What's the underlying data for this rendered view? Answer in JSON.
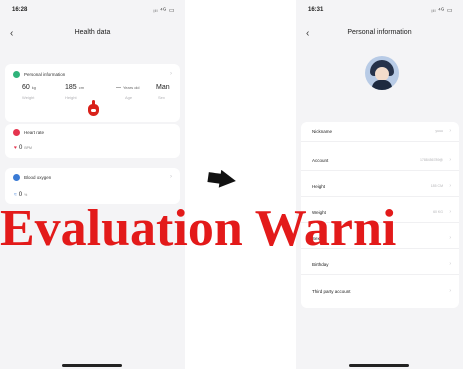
{
  "left_screen": {
    "status_time": "16:28",
    "status_icons": "ᵢₗₗ ⁴ᴳ ▭",
    "title": "Health data",
    "personal_card": {
      "title": "Personal information",
      "stats": [
        {
          "value": "60",
          "unit": "kg",
          "label": "Weight"
        },
        {
          "value": "185",
          "unit": "cm",
          "label": "Height"
        },
        {
          "value": "—",
          "unit": "Years old",
          "label": "Age"
        },
        {
          "value": "Man",
          "unit": "",
          "label": "Sex"
        }
      ]
    },
    "heart_card": {
      "title": "Heart rate",
      "value": "0",
      "unit": "BPM"
    },
    "oxygen_card": {
      "title": "Blood oxygen",
      "value": "0",
      "unit": "%"
    }
  },
  "right_screen": {
    "status_time": "16:31",
    "status_icons": "ᵢₗₗ ⁴ᴳ ▭",
    "title": "Personal information",
    "rows": [
      {
        "label": "Nickname",
        "value": "yuuu"
      },
      {
        "label": "Account",
        "value": "1788456789@"
      },
      {
        "label": "Height",
        "value": "185 CM"
      },
      {
        "label": "Weight",
        "value": "60 KG"
      },
      {
        "label": "Sex",
        "value": ""
      },
      {
        "label": "Birthday",
        "value": ""
      },
      {
        "label": "Third party account",
        "value": ""
      }
    ]
  },
  "watermark": "Evaluation Warni",
  "colors": {
    "personal": "#2fb37a",
    "heart": "#e5354f",
    "oxygen": "#3a7bd5",
    "watermark": "#e31a1a",
    "pointer": "#d9211a"
  }
}
